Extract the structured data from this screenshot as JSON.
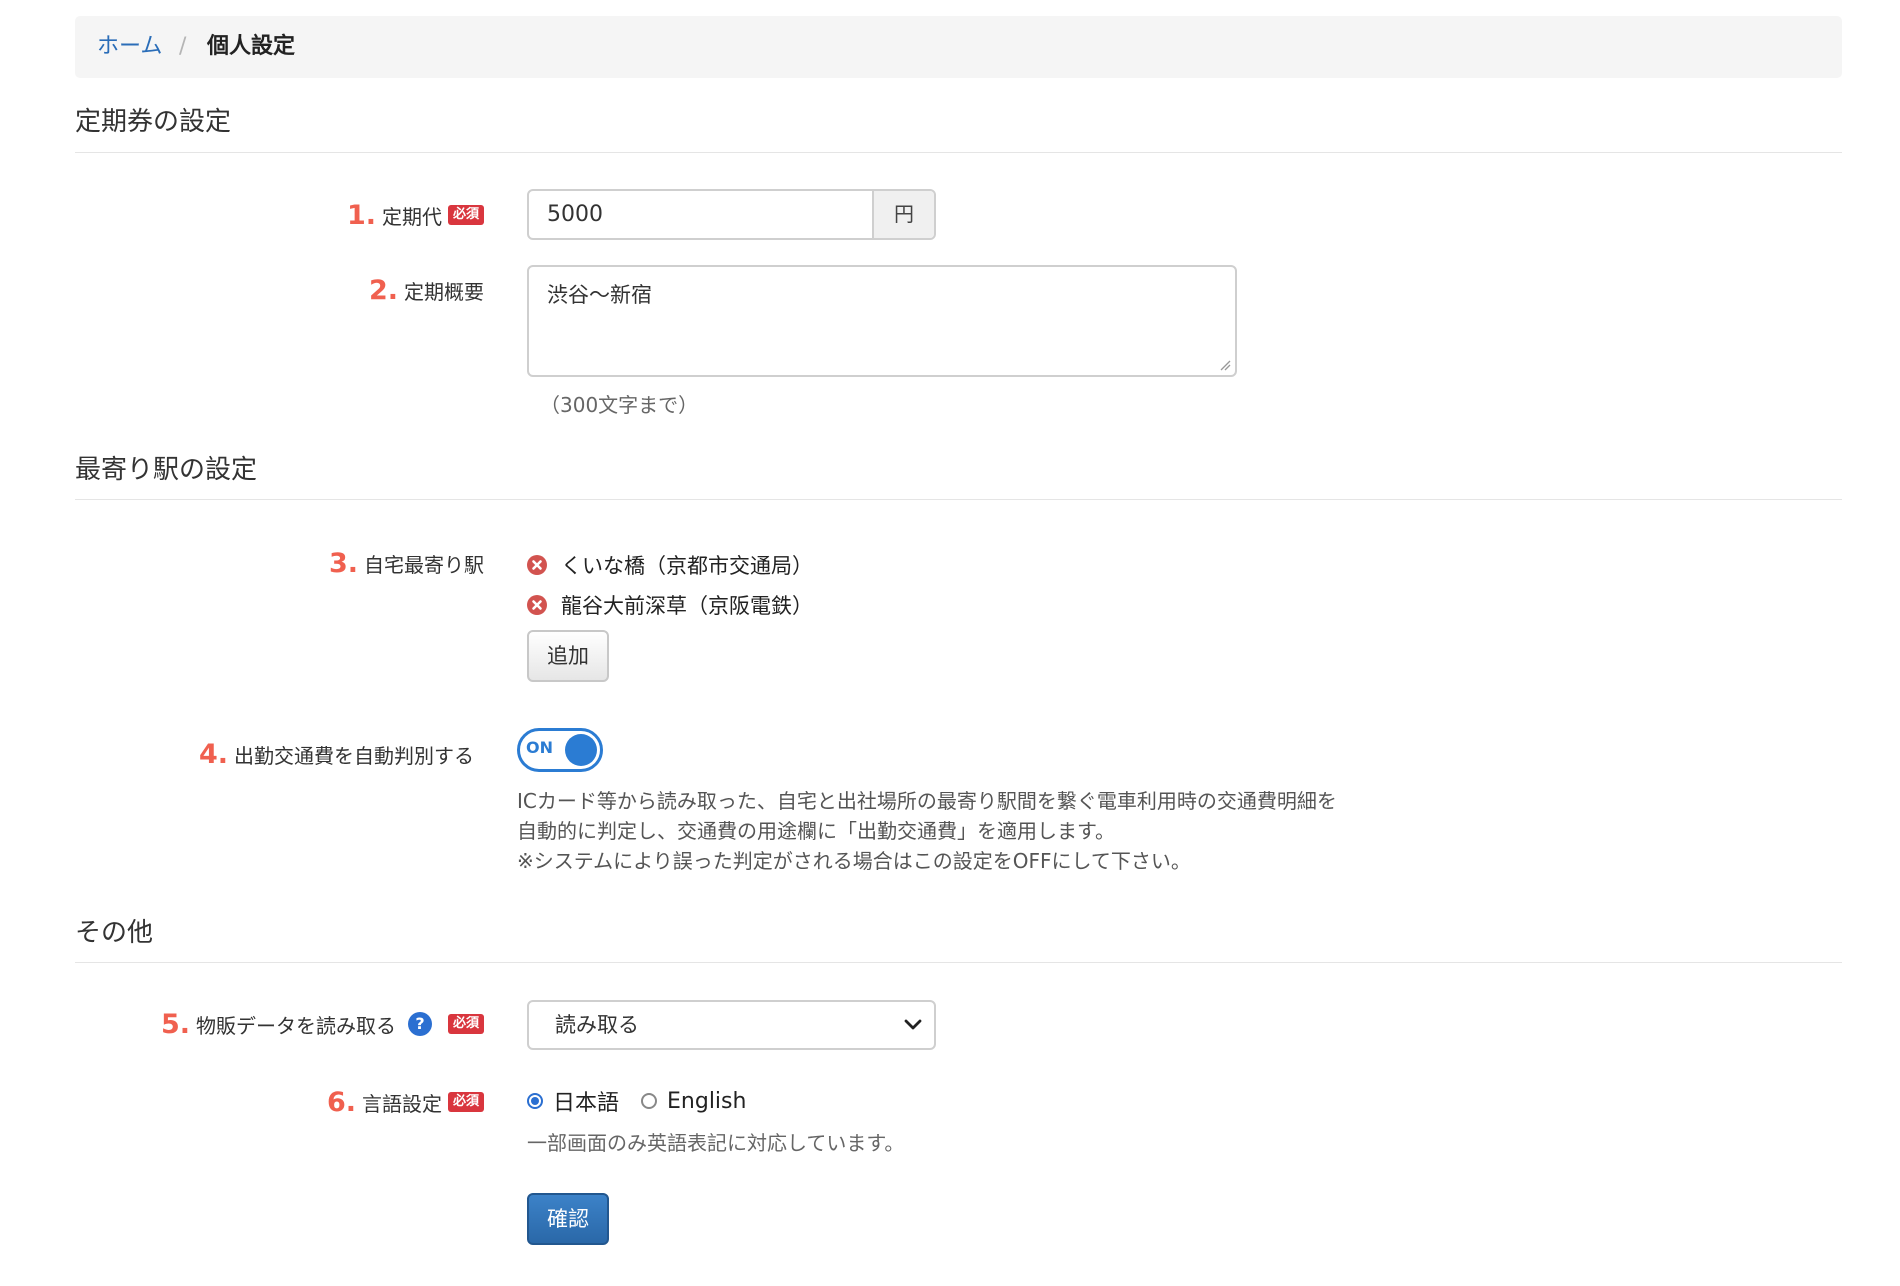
{
  "breadcrumb": {
    "home": "ホーム",
    "separator": "/",
    "current": "個人設定"
  },
  "sections": {
    "commuter_pass": "定期券の設定",
    "nearest_station": "最寄り駅の設定",
    "other": "その他"
  },
  "fields": {
    "pass_cost": {
      "num": "1.",
      "label": "定期代",
      "required": "必須",
      "value": "5000",
      "unit": "円"
    },
    "pass_summary": {
      "num": "2.",
      "label": "定期概要",
      "value": "渋谷〜新宿",
      "help": "（300文字まで）"
    },
    "home_station": {
      "num": "3.",
      "label": "自宅最寄り駅",
      "stations": [
        "くいな橋（京都市交通局）",
        "龍谷大前深草（京阪電鉄）"
      ],
      "add_button": "追加"
    },
    "auto_commute": {
      "num": "4.",
      "label": "出勤交通費を自動判別する",
      "toggle": "ON",
      "description": [
        "ICカード等から読み取った、自宅と出社場所の最寄り駅間を繋ぐ電車利用時の交通費明細を",
        "自動的に判定し、交通費の用途欄に「出勤交通費」を適用します。",
        "※システムにより誤った判定がされる場合はこの設定をOFFにして下さい。"
      ]
    },
    "sales_data": {
      "num": "5.",
      "label": "物販データを読み取る",
      "help_icon": "?",
      "required": "必須",
      "selected": "読み取る"
    },
    "language": {
      "num": "6.",
      "label": "言語設定",
      "required": "必須",
      "options": [
        "日本語",
        "English"
      ],
      "selected": "日本語",
      "help": "一部画面のみ英語表記に対応しています。"
    }
  },
  "confirm_button": "確認",
  "colors": {
    "accent": "#2b7cd3",
    "number": "#f0604f",
    "required": "#d9363e",
    "primary": "#2a68a8"
  }
}
